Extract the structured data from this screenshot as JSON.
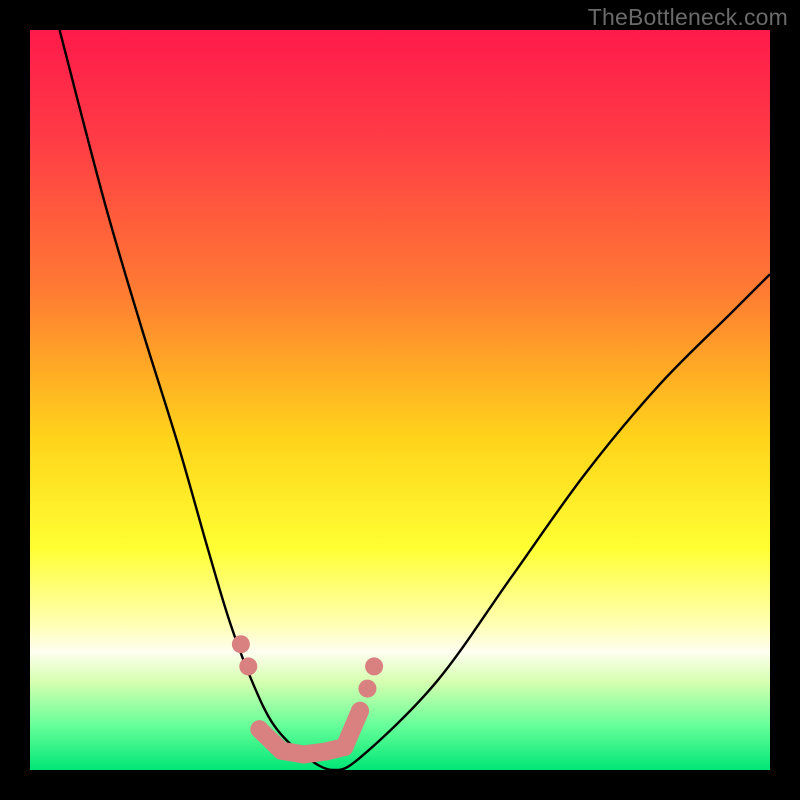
{
  "watermark": {
    "text": "TheBottleneck.com"
  },
  "chart_data": {
    "type": "line",
    "title": "",
    "xlabel": "",
    "ylabel": "",
    "xlim": [
      0,
      100
    ],
    "ylim": [
      0,
      100
    ],
    "grid": false,
    "legend": null,
    "background_gradient": {
      "stops": [
        {
          "pct": 0,
          "color": "#ff1a4b"
        },
        {
          "pct": 15,
          "color": "#ff3c45"
        },
        {
          "pct": 35,
          "color": "#ff7a33"
        },
        {
          "pct": 55,
          "color": "#ffd31a"
        },
        {
          "pct": 70,
          "color": "#ffff33"
        },
        {
          "pct": 80,
          "color": "#ffffb0"
        },
        {
          "pct": 84,
          "color": "#fefef0"
        },
        {
          "pct": 88,
          "color": "#d7ffb0"
        },
        {
          "pct": 94,
          "color": "#66ff99"
        },
        {
          "pct": 100,
          "color": "#00e676"
        }
      ]
    },
    "series": [
      {
        "name": "bottleneck-curve",
        "color": "#000000",
        "x": [
          4,
          10,
          15,
          20,
          24,
          27,
          30,
          33,
          37,
          41,
          45,
          55,
          65,
          75,
          85,
          95,
          100
        ],
        "values": [
          100,
          77,
          60,
          44,
          30,
          20,
          12,
          6,
          2,
          0,
          2,
          12,
          26,
          40,
          52,
          62,
          67
        ]
      }
    ],
    "markers": {
      "name": "highlight-dots",
      "color": "#d98080",
      "connector_color": "#d98080",
      "points": [
        {
          "x": 28.5,
          "y": 17
        },
        {
          "x": 29.5,
          "y": 14
        },
        {
          "x": 31,
          "y": 5.5
        },
        {
          "x": 34,
          "y": 2.6
        },
        {
          "x": 37,
          "y": 2.1
        },
        {
          "x": 40,
          "y": 2.5
        },
        {
          "x": 42.5,
          "y": 3.1
        },
        {
          "x": 44.6,
          "y": 8
        },
        {
          "x": 45.6,
          "y": 11
        },
        {
          "x": 46.5,
          "y": 14
        }
      ]
    }
  }
}
